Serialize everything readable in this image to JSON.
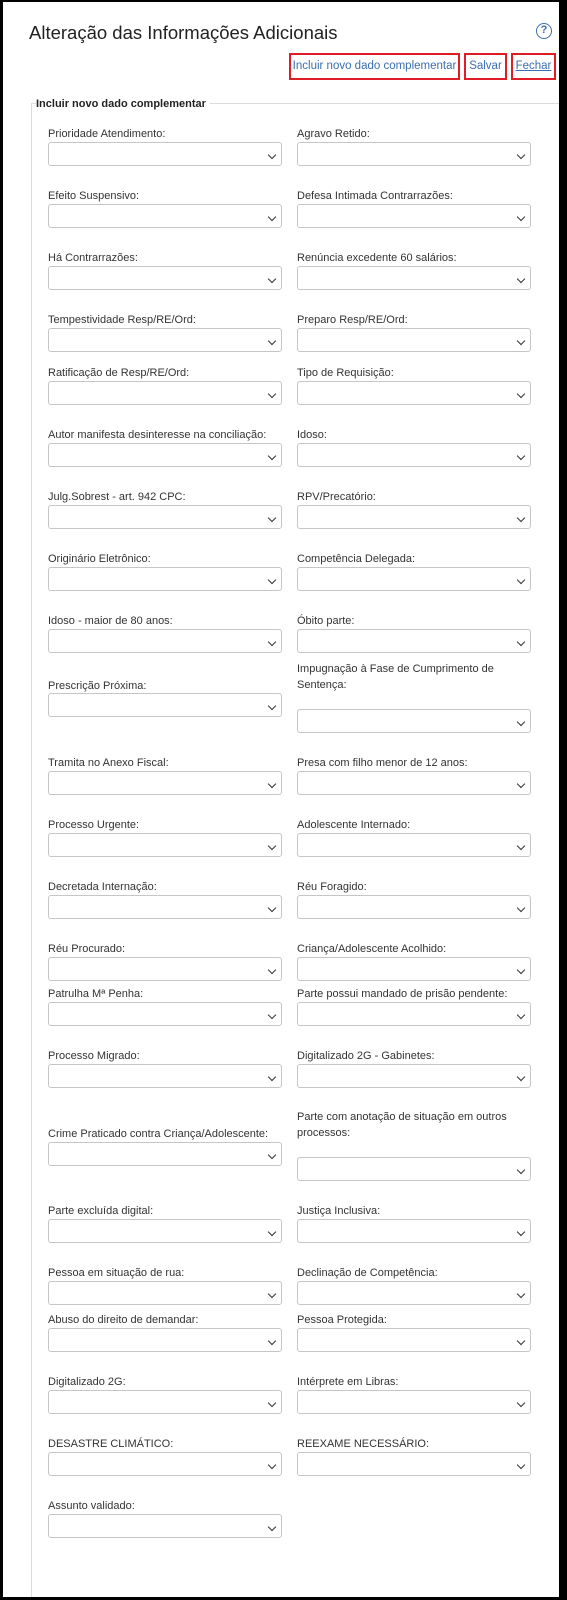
{
  "header": {
    "title": "Alteração das Informações Adicionais",
    "help_icon": "question-circle-icon",
    "buttons": {
      "incluir": "Incluir novo dado complementar",
      "salvar": "Salvar",
      "fechar": "Fechar"
    },
    "highlight_color": "#e01c24",
    "link_color": "#3a6fb0"
  },
  "section": {
    "title": "Incluir novo dado complementar"
  },
  "fields": [
    {
      "label": "Prioridade Atendimento:",
      "value": ""
    },
    {
      "label": "Agravo Retido:",
      "value": ""
    },
    {
      "label": "Efeito Suspensivo:",
      "value": ""
    },
    {
      "label": "Defesa Intimada Contrarrazões:",
      "value": ""
    },
    {
      "label": "Há Contrarrazões:",
      "value": ""
    },
    {
      "label": "Renúncia excedente 60 salários:",
      "value": ""
    },
    {
      "label": "Tempestividade Resp/RE/Ord:",
      "value": ""
    },
    {
      "label": "Preparo Resp/RE/Ord:",
      "value": ""
    },
    {
      "label": "Ratificação de Resp/RE/Ord:",
      "value": ""
    },
    {
      "label": "Tipo de Requisição:",
      "value": ""
    },
    {
      "label": "Autor manifesta desinteresse na conciliação:",
      "value": ""
    },
    {
      "label": "Idoso:",
      "value": ""
    },
    {
      "label": "Julg.Sobrest - art. 942 CPC:",
      "value": ""
    },
    {
      "label": "RPV/Precatório:",
      "value": ""
    },
    {
      "label": "Originário Eletrônico:",
      "value": ""
    },
    {
      "label": "Competência Delegada:",
      "value": ""
    },
    {
      "label": "Idoso - maior de 80 anos:",
      "value": ""
    },
    {
      "label": "Óbito parte:",
      "value": ""
    },
    {
      "label": "Prescrição Próxima:",
      "value": ""
    },
    {
      "label": "Impugnação à Fase de Cumprimento de Sentença:",
      "value": ""
    },
    {
      "label": "Tramita no Anexo Fiscal:",
      "value": ""
    },
    {
      "label": "Presa com filho menor de 12 anos:",
      "value": ""
    },
    {
      "label": "Processo Urgente:",
      "value": ""
    },
    {
      "label": "Adolescente Internado:",
      "value": ""
    },
    {
      "label": "Decretada Internação:",
      "value": ""
    },
    {
      "label": "Réu Foragido:",
      "value": ""
    },
    {
      "label": "Réu Procurado:",
      "value": ""
    },
    {
      "label": "Criança/Adolescente Acolhido:",
      "value": ""
    },
    {
      "label": "Patrulha Mª Penha:",
      "value": ""
    },
    {
      "label": "Parte possui mandado de prisão pendente:",
      "value": ""
    },
    {
      "label": "Processo Migrado:",
      "value": ""
    },
    {
      "label": "Digitalizado 2G - Gabinetes:",
      "value": ""
    },
    {
      "label": "Crime Praticado contra Criança/Adolescente:",
      "value": ""
    },
    {
      "label": "Parte com anotação de situação em outros processos:",
      "value": ""
    },
    {
      "label": "Parte excluída digital:",
      "value": ""
    },
    {
      "label": "Justiça Inclusiva:",
      "value": ""
    },
    {
      "label": "Pessoa em situação de rua:",
      "value": ""
    },
    {
      "label": "Declinação de Competência:",
      "value": ""
    },
    {
      "label": "Abuso do direito de demandar:",
      "value": ""
    },
    {
      "label": "Pessoa Protegida:",
      "value": ""
    },
    {
      "label": "Digitalizado 2G:",
      "value": ""
    },
    {
      "label": "Intérprete em Libras:",
      "value": ""
    },
    {
      "label": "DESASTRE CLIMÁTICO:",
      "value": ""
    },
    {
      "label": "REEXAME NECESSÁRIO:",
      "value": ""
    },
    {
      "label": "Assunto validado:",
      "value": ""
    }
  ]
}
